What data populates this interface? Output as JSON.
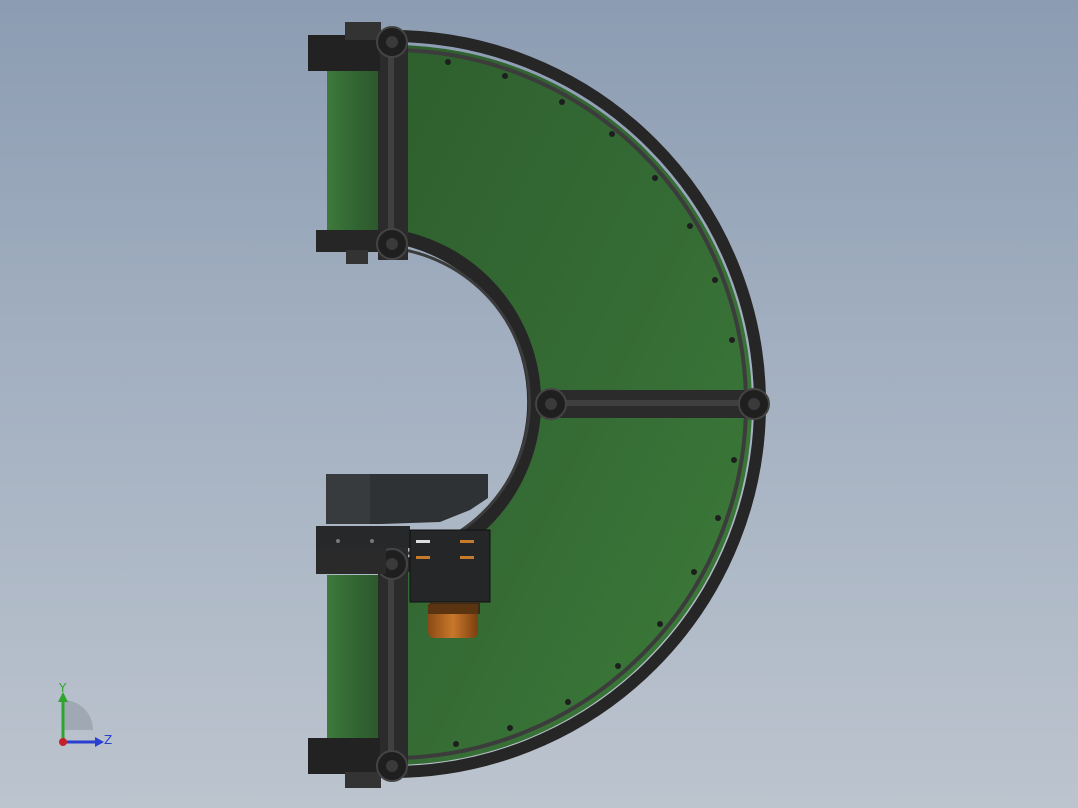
{
  "viewport": {
    "background_top": "#8c9cb2",
    "background_bottom": "#bcc4ce"
  },
  "model": {
    "belt_color": "#3a7a3a",
    "belt_shade": "#2f5f2f",
    "frame_color": "#2a2a2a",
    "motor_color": "#b8651f"
  },
  "triad": {
    "y_label": "Y",
    "z_label": "Z",
    "y_color": "#2fa52f",
    "z_color": "#2a3fd0",
    "x_color": "#c8202a"
  }
}
